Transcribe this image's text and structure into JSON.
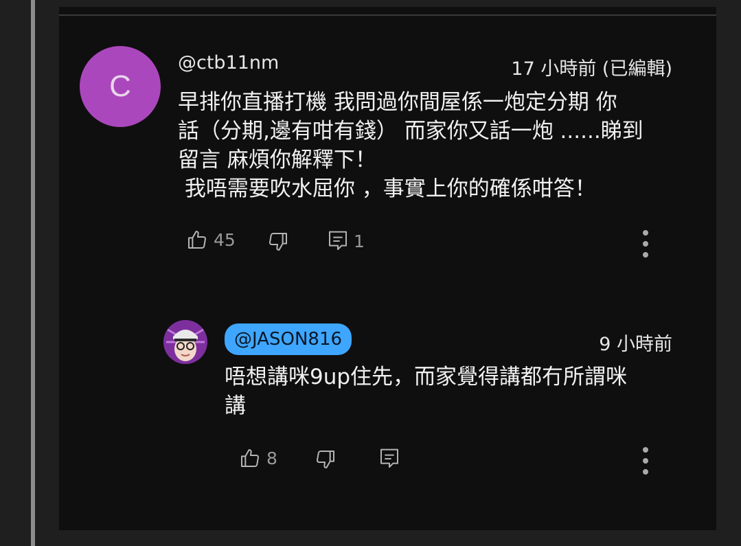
{
  "comment": {
    "avatar_letter": "C",
    "author": "@ctb11nm",
    "time": "17 小時前 (已編輯)",
    "text_lines": [
      "早排你直播打機 我問過你間屋係一炮定分期 你",
      "話（分期,邊有咁有錢） 而家你又話一炮 ......睇到",
      "留言 麻煩你解釋下！",
      " 我唔需要吹水屈你 ，事實上你的確係咁答！"
    ],
    "likes": "45",
    "replies": "1"
  },
  "reply": {
    "author": "@JASON816",
    "time": "9 小時前",
    "text_lines": [
      "唔想講咪9up住先，而家覺得講都冇所謂咪",
      "講"
    ],
    "likes": "8"
  },
  "icons": {
    "like": "thumbs-up-icon",
    "dislike": "thumbs-down-icon",
    "reply": "reply-comment-icon",
    "more": "more-vertical-icon"
  },
  "colors": {
    "avatar_bg": "#ab47bc",
    "chip_bg": "#3ea6ff",
    "panel_bg": "#0f0f0f"
  }
}
